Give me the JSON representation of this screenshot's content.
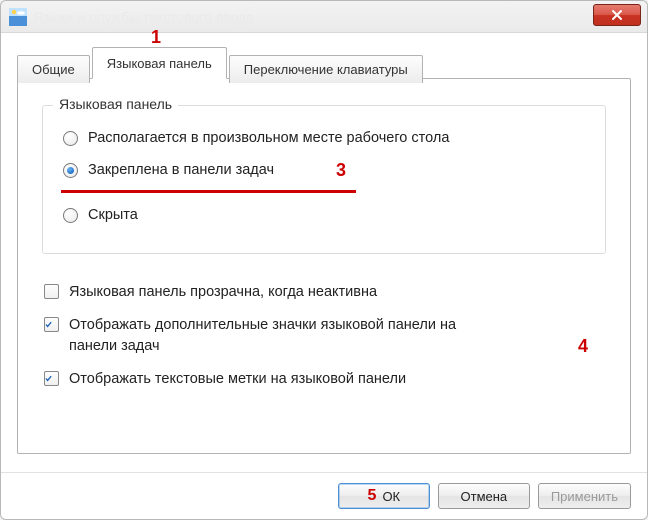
{
  "window": {
    "title": "Языки и службы текстового ввода"
  },
  "tabs": {
    "general": "Общие",
    "langbar": "Языковая панель",
    "hotkeys": "Переключение клавиатуры"
  },
  "group": {
    "legend": "Языковая панель",
    "radio_float": "Располагается в произвольном месте рабочего стола",
    "radio_docked": "Закреплена в панели задач",
    "radio_hidden": "Скрыта"
  },
  "checks": {
    "transparent": "Языковая панель прозрачна, когда неактивна",
    "extra_icons": "Отображать дополнительные значки языковой панели на панели задач",
    "text_labels": "Отображать текстовые метки на языковой панели"
  },
  "buttons": {
    "ok": "ОК",
    "cancel": "Отмена",
    "apply": "Применить"
  },
  "annotations": {
    "a1": "1",
    "a3": "3",
    "a4": "4",
    "a5": "5"
  }
}
